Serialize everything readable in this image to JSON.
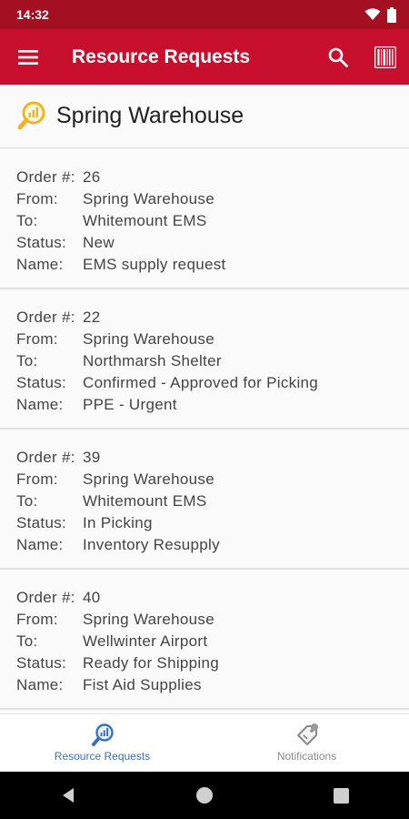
{
  "status_bar": {
    "time": "14:32"
  },
  "app_bar": {
    "title": "Resource Requests"
  },
  "warehouse": {
    "name": "Spring Warehouse"
  },
  "labels": {
    "order": "Order #:",
    "from": "From:",
    "to": "To:",
    "status": "Status:",
    "name": "Name:"
  },
  "orders": [
    {
      "number": "26",
      "from": "Spring Warehouse",
      "to": "Whitemount EMS",
      "status": "New",
      "name": "EMS supply request"
    },
    {
      "number": "22",
      "from": "Spring Warehouse",
      "to": "Northmarsh Shelter",
      "status": "Confirmed - Approved for Picking",
      "name": "PPE - Urgent"
    },
    {
      "number": "39",
      "from": "Spring Warehouse",
      "to": "Whitemount EMS",
      "status": "In Picking",
      "name": "Inventory Resupply"
    },
    {
      "number": "40",
      "from": "Spring Warehouse",
      "to": "Wellwinter Airport",
      "status": "Ready for Shipping",
      "name": "Fist Aid Supplies"
    }
  ],
  "bottom_nav": [
    {
      "label": "Resource Requests",
      "icon": "resource-requests-icon",
      "active": true
    },
    {
      "label": "Notifications",
      "icon": "notifications-icon",
      "active": false
    }
  ],
  "colors": {
    "status_bar": "#a50f22",
    "app_bar": "#c8102e",
    "active_tab": "#3a6fc4",
    "inactive_tab": "#8a8a8a",
    "warehouse_icon": "#f0b429"
  }
}
